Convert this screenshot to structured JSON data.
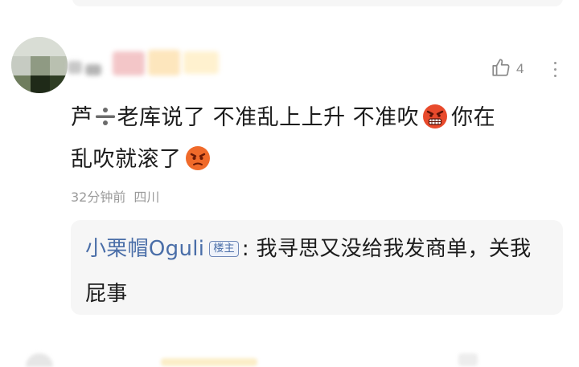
{
  "comment": {
    "like_count": "4",
    "body": {
      "prefix": "芦",
      "line1_part1": "老库说了 不准乱上上升 不准吹",
      "line1_part2": "你在",
      "line2": "乱吹就滚了"
    },
    "meta": {
      "time": "32分钟前",
      "location": "四川"
    },
    "emojis": [
      "angry-face-icon",
      "pouting-face-icon"
    ]
  },
  "reply": {
    "author": "小栗帽Ogul",
    "author_tail": "i",
    "badge": "楼主",
    "separator": ":",
    "text": " 我寻思又没给我发商单，关我屁事"
  },
  "colors": {
    "reply_author": "#4a6ea8",
    "meta_text": "#9a9a9a",
    "card_bg": "#f6f6f6"
  }
}
